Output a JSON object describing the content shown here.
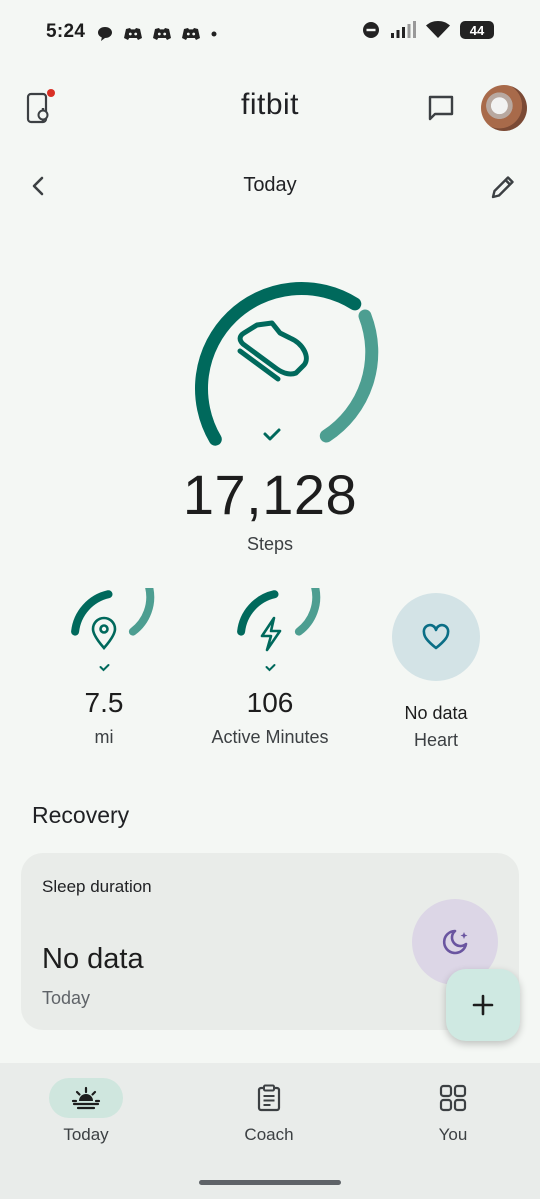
{
  "status_bar": {
    "time": "5:24",
    "battery": "44"
  },
  "header": {
    "app_name": "fitbit"
  },
  "date_nav": {
    "title": "Today"
  },
  "steps": {
    "value": "17,128",
    "label": "Steps",
    "progress": 0.78
  },
  "stats": [
    {
      "value": "7.5",
      "label": "mi",
      "progress": 0.78
    },
    {
      "value": "106",
      "label": "Active Minutes",
      "progress": 0.78
    },
    {
      "value": "No data",
      "label": "Heart"
    }
  ],
  "recovery": {
    "title": "Recovery",
    "card": {
      "title": "Sleep duration",
      "value": "No data",
      "subtitle": "Today"
    }
  },
  "bottom_nav": [
    {
      "label": "Today",
      "icon": "sunrise-icon",
      "active": true
    },
    {
      "label": "Coach",
      "icon": "clipboard-icon",
      "active": false
    },
    {
      "label": "You",
      "icon": "grid-icon",
      "active": false
    }
  ],
  "colors": {
    "accent_dark": "#00695c",
    "accent_light": "#4d9e91",
    "background": "#f4f7f4"
  }
}
